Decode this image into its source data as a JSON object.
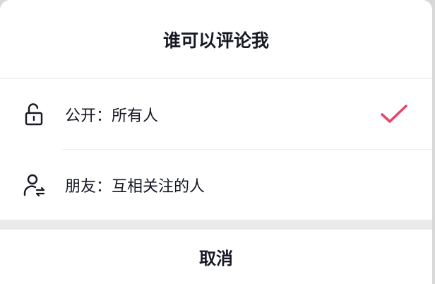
{
  "sheet": {
    "title": "谁可以评论我",
    "cancel_label": "取消"
  },
  "options": [
    {
      "label": "公开：所有人",
      "icon": "unlock-icon",
      "selected": true
    },
    {
      "label": "朋友：互相关注的人",
      "icon": "friends-icon",
      "selected": false
    }
  ],
  "colors": {
    "accent": "#e8456b",
    "text": "#161823",
    "separator": "#eaeaea"
  }
}
